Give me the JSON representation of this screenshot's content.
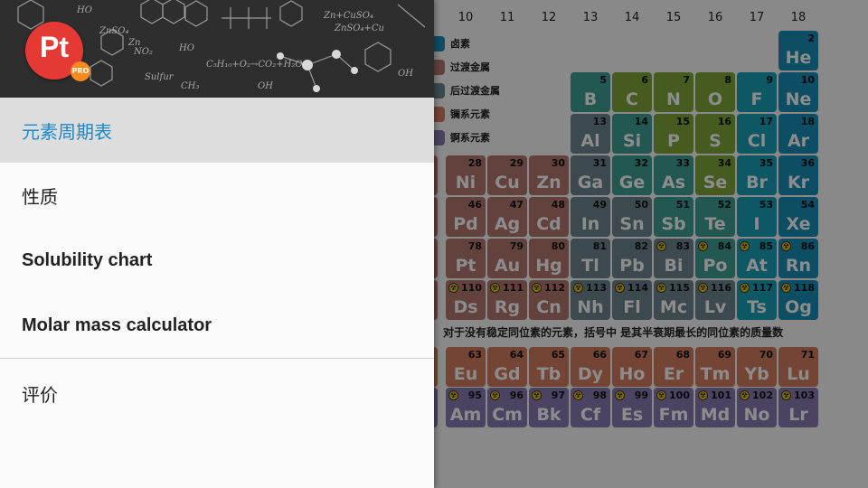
{
  "drawer": {
    "logo_text": "Pt",
    "pro_badge": "PRO",
    "items": [
      {
        "label": "元素周期表",
        "active": true
      },
      {
        "label": "性质",
        "active": false
      },
      {
        "label": "Solubility chart",
        "active": false
      },
      {
        "label": "Molar mass calculator",
        "active": false
      },
      {
        "label": "评价",
        "active": false
      }
    ]
  },
  "table": {
    "group_numbers": [
      "10",
      "11",
      "12",
      "13",
      "14",
      "15",
      "16",
      "17",
      "18"
    ],
    "legend": [
      "卤素",
      "过渡金属",
      "后过渡金属",
      "镧系元素",
      "锕系元素"
    ],
    "legend_colors": [
      "#1a8fb8",
      "#b5776f",
      "#6d8791",
      "#d47e62",
      "#8b78b3"
    ],
    "note": "对于没有稳定同位素的元素，括号中 是其半衰期最长的同位素的质量数",
    "colors": {
      "noble": "#1a8fb8",
      "halogen": "#1a9fb8",
      "nonmetal": "#7ea63a",
      "metalloid": "#3f9f96",
      "post": "#6d8791",
      "transition": "#b5776f",
      "lanthanide": "#d47e62",
      "actinide": "#8b78b3"
    },
    "elements": [
      {
        "n": "2",
        "s": "He",
        "c": "noble",
        "col": 8,
        "row": 0
      },
      {
        "n": "5",
        "s": "B",
        "c": "metalloid",
        "col": 3,
        "row": 1
      },
      {
        "n": "6",
        "s": "C",
        "c": "nonmetal",
        "col": 4,
        "row": 1
      },
      {
        "n": "7",
        "s": "N",
        "c": "nonmetal",
        "col": 5,
        "row": 1
      },
      {
        "n": "8",
        "s": "O",
        "c": "nonmetal",
        "col": 6,
        "row": 1
      },
      {
        "n": "9",
        "s": "F",
        "c": "halogen",
        "col": 7,
        "row": 1
      },
      {
        "n": "10",
        "s": "Ne",
        "c": "noble",
        "col": 8,
        "row": 1
      },
      {
        "n": "13",
        "s": "Al",
        "c": "post",
        "col": 3,
        "row": 2
      },
      {
        "n": "14",
        "s": "Si",
        "c": "metalloid",
        "col": 4,
        "row": 2
      },
      {
        "n": "15",
        "s": "P",
        "c": "nonmetal",
        "col": 5,
        "row": 2
      },
      {
        "n": "16",
        "s": "S",
        "c": "nonmetal",
        "col": 6,
        "row": 2
      },
      {
        "n": "17",
        "s": "Cl",
        "c": "halogen",
        "col": 7,
        "row": 2
      },
      {
        "n": "18",
        "s": "Ar",
        "c": "noble",
        "col": 8,
        "row": 2
      },
      {
        "n": "28",
        "s": "Ni",
        "c": "transition",
        "col": 0,
        "row": 3
      },
      {
        "n": "29",
        "s": "Cu",
        "c": "transition",
        "col": 1,
        "row": 3
      },
      {
        "n": "30",
        "s": "Zn",
        "c": "transition",
        "col": 2,
        "row": 3
      },
      {
        "n": "31",
        "s": "Ga",
        "c": "post",
        "col": 3,
        "row": 3
      },
      {
        "n": "32",
        "s": "Ge",
        "c": "metalloid",
        "col": 4,
        "row": 3
      },
      {
        "n": "33",
        "s": "As",
        "c": "metalloid",
        "col": 5,
        "row": 3
      },
      {
        "n": "34",
        "s": "Se",
        "c": "nonmetal",
        "col": 6,
        "row": 3
      },
      {
        "n": "35",
        "s": "Br",
        "c": "halogen",
        "col": 7,
        "row": 3
      },
      {
        "n": "36",
        "s": "Kr",
        "c": "noble",
        "col": 8,
        "row": 3
      },
      {
        "n": "46",
        "s": "Pd",
        "c": "transition",
        "col": 0,
        "row": 4
      },
      {
        "n": "47",
        "s": "Ag",
        "c": "transition",
        "col": 1,
        "row": 4
      },
      {
        "n": "48",
        "s": "Cd",
        "c": "transition",
        "col": 2,
        "row": 4
      },
      {
        "n": "49",
        "s": "In",
        "c": "post",
        "col": 3,
        "row": 4
      },
      {
        "n": "50",
        "s": "Sn",
        "c": "post",
        "col": 4,
        "row": 4
      },
      {
        "n": "51",
        "s": "Sb",
        "c": "metalloid",
        "col": 5,
        "row": 4
      },
      {
        "n": "52",
        "s": "Te",
        "c": "metalloid",
        "col": 6,
        "row": 4
      },
      {
        "n": "53",
        "s": "I",
        "c": "halogen",
        "col": 7,
        "row": 4
      },
      {
        "n": "54",
        "s": "Xe",
        "c": "noble",
        "col": 8,
        "row": 4
      },
      {
        "n": "78",
        "s": "Pt",
        "c": "transition",
        "col": 0,
        "row": 5
      },
      {
        "n": "79",
        "s": "Au",
        "c": "transition",
        "col": 1,
        "row": 5
      },
      {
        "n": "80",
        "s": "Hg",
        "c": "transition",
        "col": 2,
        "row": 5
      },
      {
        "n": "81",
        "s": "Tl",
        "c": "post",
        "col": 3,
        "row": 5
      },
      {
        "n": "82",
        "s": "Pb",
        "c": "post",
        "col": 4,
        "row": 5
      },
      {
        "n": "83",
        "s": "Bi",
        "c": "post",
        "col": 5,
        "row": 5,
        "rad": true
      },
      {
        "n": "84",
        "s": "Po",
        "c": "metalloid",
        "col": 6,
        "row": 5,
        "rad": true
      },
      {
        "n": "85",
        "s": "At",
        "c": "halogen",
        "col": 7,
        "row": 5,
        "rad": true
      },
      {
        "n": "86",
        "s": "Rn",
        "c": "noble",
        "col": 8,
        "row": 5,
        "rad": true
      },
      {
        "n": "110",
        "s": "Ds",
        "c": "transition",
        "col": 0,
        "row": 6,
        "rad": true
      },
      {
        "n": "111",
        "s": "Rg",
        "c": "transition",
        "col": 1,
        "row": 6,
        "rad": true
      },
      {
        "n": "112",
        "s": "Cn",
        "c": "transition",
        "col": 2,
        "row": 6,
        "rad": true
      },
      {
        "n": "113",
        "s": "Nh",
        "c": "post",
        "col": 3,
        "row": 6,
        "rad": true
      },
      {
        "n": "114",
        "s": "Fl",
        "c": "post",
        "col": 4,
        "row": 6,
        "rad": true
      },
      {
        "n": "115",
        "s": "Mc",
        "c": "post",
        "col": 5,
        "row": 6,
        "rad": true
      },
      {
        "n": "116",
        "s": "Lv",
        "c": "post",
        "col": 6,
        "row": 6,
        "rad": true
      },
      {
        "n": "117",
        "s": "Ts",
        "c": "halogen",
        "col": 7,
        "row": 6,
        "rad": true
      },
      {
        "n": "118",
        "s": "Og",
        "c": "noble",
        "col": 8,
        "row": 6,
        "rad": true
      },
      {
        "n": "63",
        "s": "Eu",
        "c": "lanthanide",
        "col": 0,
        "row": 8
      },
      {
        "n": "64",
        "s": "Gd",
        "c": "lanthanide",
        "col": 1,
        "row": 8
      },
      {
        "n": "65",
        "s": "Tb",
        "c": "lanthanide",
        "col": 2,
        "row": 8
      },
      {
        "n": "66",
        "s": "Dy",
        "c": "lanthanide",
        "col": 3,
        "row": 8
      },
      {
        "n": "67",
        "s": "Ho",
        "c": "lanthanide",
        "col": 4,
        "row": 8
      },
      {
        "n": "68",
        "s": "Er",
        "c": "lanthanide",
        "col": 5,
        "row": 8
      },
      {
        "n": "69",
        "s": "Tm",
        "c": "lanthanide",
        "col": 6,
        "row": 8
      },
      {
        "n": "70",
        "s": "Yb",
        "c": "lanthanide",
        "col": 7,
        "row": 8
      },
      {
        "n": "71",
        "s": "Lu",
        "c": "lanthanide",
        "col": 8,
        "row": 8
      },
      {
        "n": "95",
        "s": "Am",
        "c": "actinide",
        "col": 0,
        "row": 9,
        "rad": true
      },
      {
        "n": "96",
        "s": "Cm",
        "c": "actinide",
        "col": 1,
        "row": 9,
        "rad": true
      },
      {
        "n": "97",
        "s": "Bk",
        "c": "actinide",
        "col": 2,
        "row": 9,
        "rad": true
      },
      {
        "n": "98",
        "s": "Cf",
        "c": "actinide",
        "col": 3,
        "row": 9,
        "rad": true
      },
      {
        "n": "99",
        "s": "Es",
        "c": "actinide",
        "col": 4,
        "row": 9,
        "rad": true
      },
      {
        "n": "100",
        "s": "Fm",
        "c": "actinide",
        "col": 5,
        "row": 9,
        "rad": true
      },
      {
        "n": "101",
        "s": "Md",
        "c": "actinide",
        "col": 6,
        "row": 9,
        "rad": true
      },
      {
        "n": "102",
        "s": "No",
        "c": "actinide",
        "col": 7,
        "row": 9,
        "rad": true
      },
      {
        "n": "103",
        "s": "Lr",
        "c": "actinide",
        "col": 8,
        "row": 9,
        "rad": true
      }
    ]
  }
}
